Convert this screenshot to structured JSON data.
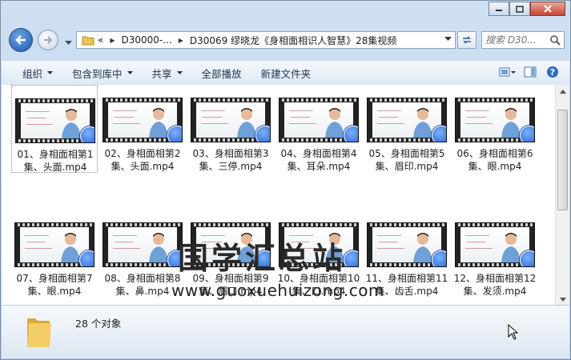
{
  "window": {
    "caption_buttons": [
      "minimize",
      "maximize",
      "close"
    ]
  },
  "nav": {
    "breadcrumb": [
      {
        "label": "«"
      },
      {
        "label": "D30000-..."
      },
      {
        "label": "D30069 缪晓龙《身相面相识人智慧》28集视频"
      }
    ],
    "search_placeholder": "搜索 D30...",
    "icons": [
      "back-arrow-icon",
      "forward-arrow-icon",
      "folder-icon",
      "refresh-icon",
      "search-icon"
    ]
  },
  "toolbar": {
    "organize": "组织",
    "include_library": "包含到库中",
    "share": "共享",
    "play_all": "全部播放",
    "new_folder": "新建文件夹"
  },
  "files": [
    {
      "name": "01、身相面相第1集、头面.mp4"
    },
    {
      "name": "02、身相面相第2集、头面.mp4"
    },
    {
      "name": "03、身相面相第3集、三停.mp4"
    },
    {
      "name": "04、身相面相第4集、耳朵.mp4"
    },
    {
      "name": "05、身相面相第5集、眉印.mp4"
    },
    {
      "name": "06、身相面相第6集、眼.mp4"
    },
    {
      "name": "07、身相面相第7集、眼.mp4"
    },
    {
      "name": "08、身相面相第8集、鼻.mp4"
    },
    {
      "name": "09、身相面相第9集、眉口.mp4"
    },
    {
      "name": "10、身相面相第10集、口.mp4"
    },
    {
      "name": "11、身相面相第11集、齿舌.mp4"
    },
    {
      "name": "12、身相面相第12集、发须.mp4"
    }
  ],
  "watermark": {
    "cn": "国学汇总站",
    "url": "www.guoxuehuizong.com"
  },
  "status": {
    "count": "28 个对象"
  },
  "colors": {
    "titlebar": "#cfe0f3",
    "badge": "#1f55c6",
    "close": "#c9452f"
  }
}
